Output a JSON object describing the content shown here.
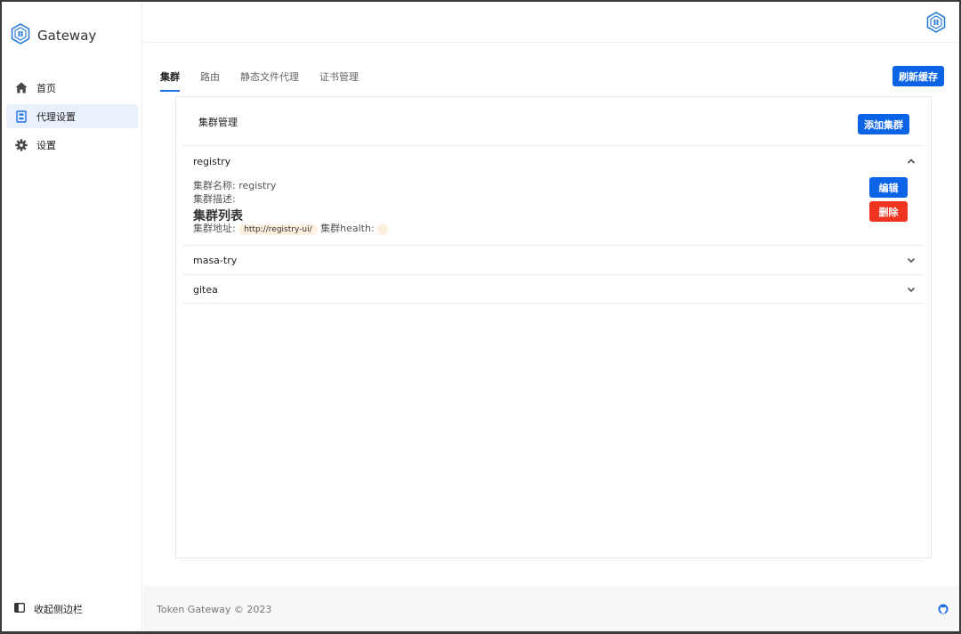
{
  "app": {
    "name": "Gateway"
  },
  "sidebar": {
    "items": [
      {
        "label": "首页",
        "icon": "home-icon"
      },
      {
        "label": "代理设置",
        "icon": "proxy-icon"
      },
      {
        "label": "设置",
        "icon": "gear-icon"
      }
    ],
    "collapse_label": "收起侧边栏"
  },
  "tabs": [
    {
      "label": "集群",
      "active": true
    },
    {
      "label": "路由"
    },
    {
      "label": "静态文件代理"
    },
    {
      "label": "证书管理"
    }
  ],
  "toolbar": {
    "refresh_label": "刷新缓存"
  },
  "cluster_panel": {
    "title": "集群管理",
    "add_label": "添加集群",
    "clusters": [
      {
        "name": "registry",
        "expanded": true,
        "name_field_label": "集群名称:",
        "name_field_value": "registry",
        "desc_field_label": "集群描述:",
        "desc_field_value": "",
        "list_title": "集群列表",
        "address_label": "集群地址:",
        "address_value": "http://registry-ui/",
        "health_label": "集群health:",
        "health_value": "",
        "edit_label": "编辑",
        "delete_label": "删除"
      },
      {
        "name": "masa-try",
        "expanded": false
      },
      {
        "name": "gitea",
        "expanded": false
      }
    ]
  },
  "footer": {
    "text": "Token Gateway © 2023"
  },
  "colors": {
    "primary": "#0b63e5",
    "danger": "#f0341f",
    "active_bg": "#e9f2fc",
    "pill_bg": "#fdf0df"
  }
}
